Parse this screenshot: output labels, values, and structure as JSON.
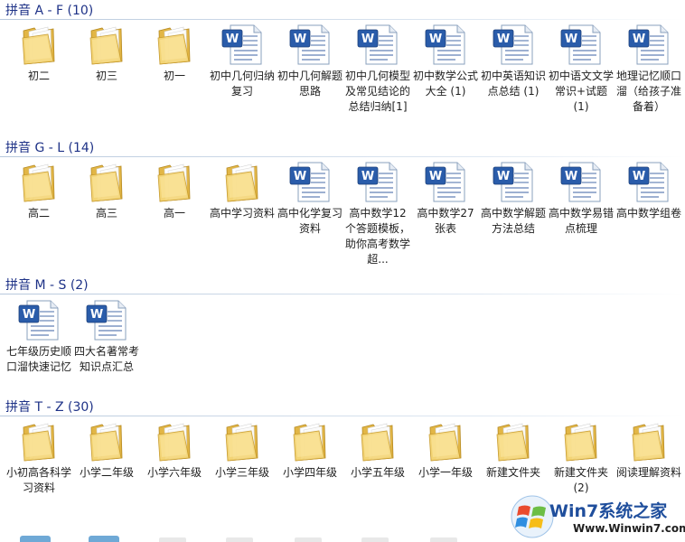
{
  "groups": [
    {
      "header": "拼音 A - F (10)",
      "items": [
        {
          "label": "初二",
          "icon": "folder-icon"
        },
        {
          "label": "初三",
          "icon": "folder-icon"
        },
        {
          "label": "初一",
          "icon": "folder-icon"
        },
        {
          "label": "初中几何归纳复习",
          "icon": "word-document-icon"
        },
        {
          "label": "初中几何解题思路",
          "icon": "word-document-icon"
        },
        {
          "label": "初中几何模型及常见结论的总结归纳[1]",
          "icon": "word-document-icon"
        },
        {
          "label": "初中数学公式大全 (1)",
          "icon": "word-document-icon"
        },
        {
          "label": "初中英语知识点总结 (1)",
          "icon": "word-document-icon"
        },
        {
          "label": "初中语文文学常识+试题 (1)",
          "icon": "word-document-icon"
        },
        {
          "label": "地理记忆顺口溜（给孩子准备着）",
          "icon": "word-document-icon"
        }
      ]
    },
    {
      "header": "拼音 G - L (14)",
      "items": [
        {
          "label": "高二",
          "icon": "folder-icon"
        },
        {
          "label": "高三",
          "icon": "folder-icon"
        },
        {
          "label": "高一",
          "icon": "folder-icon"
        },
        {
          "label": "高中学习资料",
          "icon": "folder-icon"
        },
        {
          "label": "高中化学复习资料",
          "icon": "word-document-icon"
        },
        {
          "label": "高中数学12个答题模板，助你高考数学超...",
          "icon": "word-document-icon"
        },
        {
          "label": "高中数学27张表",
          "icon": "word-document-icon"
        },
        {
          "label": "高中数学解题方法总结",
          "icon": "word-document-icon"
        },
        {
          "label": "高中数学易错点梳理",
          "icon": "word-document-icon"
        },
        {
          "label": "高中数学组卷",
          "icon": "word-document-icon"
        }
      ]
    },
    {
      "header": "拼音 M - S (2)",
      "items": [
        {
          "label": "七年级历史顺口溜快速记忆",
          "icon": "word-document-icon"
        },
        {
          "label": "四大名著常考知识点汇总",
          "icon": "word-document-icon"
        }
      ]
    },
    {
      "header": "拼音 T - Z (30)",
      "items": [
        {
          "label": "小初高各科学习资料",
          "icon": "folder-icon"
        },
        {
          "label": "小学二年级",
          "icon": "folder-icon"
        },
        {
          "label": "小学六年级",
          "icon": "folder-icon"
        },
        {
          "label": "小学三年级",
          "icon": "folder-icon"
        },
        {
          "label": "小学四年级",
          "icon": "folder-icon"
        },
        {
          "label": "小学五年级",
          "icon": "folder-icon"
        },
        {
          "label": "小学一年级",
          "icon": "folder-icon"
        },
        {
          "label": "新建文件夹",
          "icon": "folder-icon"
        },
        {
          "label": "新建文件夹 (2)",
          "icon": "folder-icon"
        },
        {
          "label": "阅读理解资料",
          "icon": "folder-icon"
        }
      ]
    }
  ],
  "watermark": {
    "brand": "Win7系统之家",
    "url": "Www.Winwin7.com"
  },
  "colors": {
    "header_text": "#1e3287",
    "folder_yellow": "#f2d77a",
    "word_blue": "#2a5caa"
  }
}
